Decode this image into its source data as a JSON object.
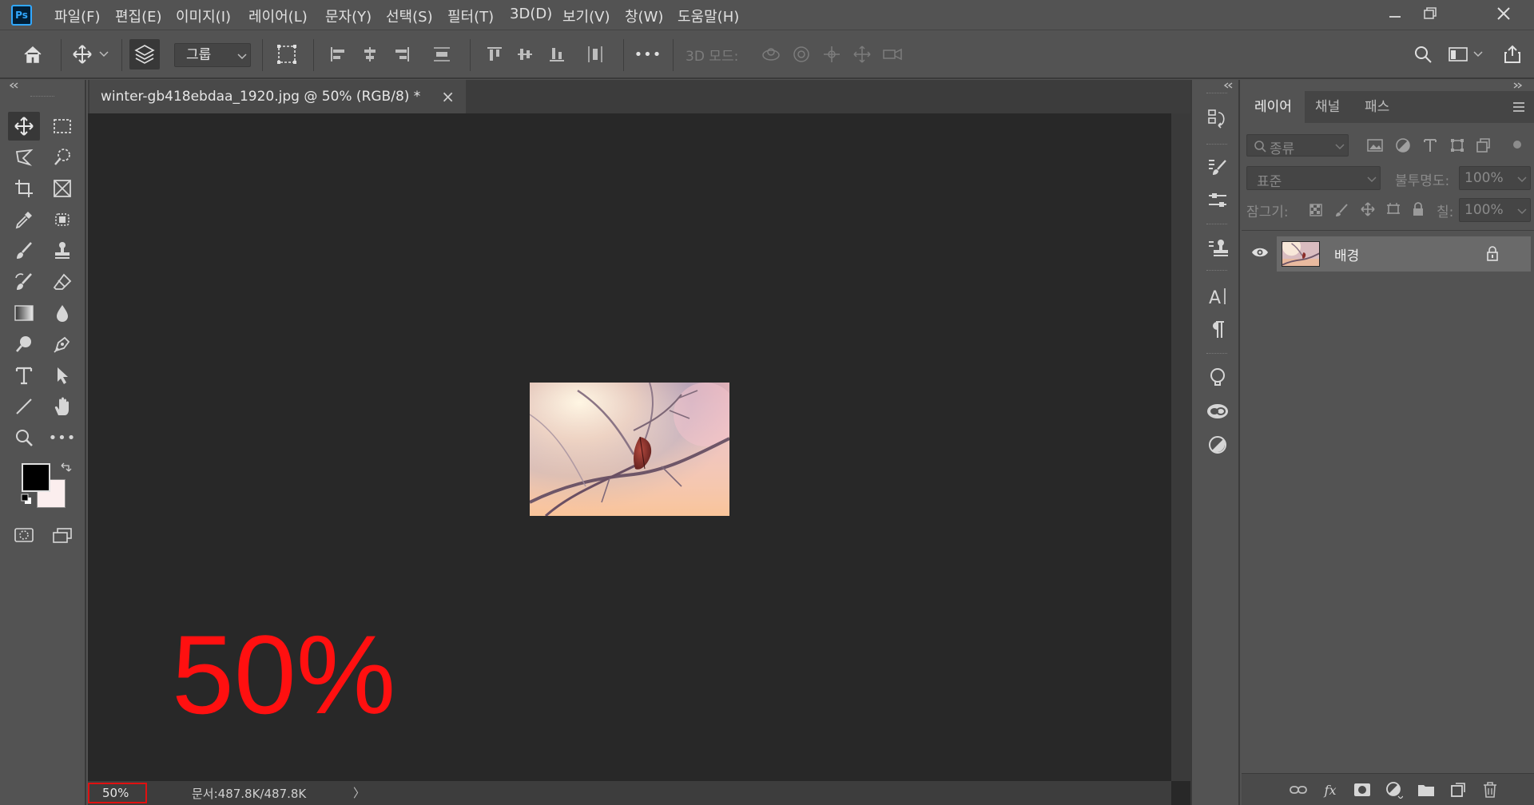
{
  "app": {
    "logo": "Ps"
  },
  "menu": [
    "파일(F)",
    "편집(E)",
    "이미지(I)",
    "레이어(L)",
    "문자(Y)",
    "선택(S)",
    "필터(T)",
    "3D(D)",
    "보기(V)",
    "창(W)",
    "도움말(H)"
  ],
  "options": {
    "group_label": "그룹",
    "mode3d_label": "3D 모드:",
    "more_label": "•••"
  },
  "document": {
    "tab_title": "winter-gb418ebdaa_1920.jpg @ 50% (RGB/8) *",
    "tab_close": "×",
    "zoom_overlay": "50%"
  },
  "status": {
    "zoom": "50%",
    "doc_info": "문서:487.8K/487.8K",
    "arrow": "〉"
  },
  "layers_panel": {
    "tabs": [
      "레이어",
      "채널",
      "패스"
    ],
    "filter_placeholder": "종류",
    "blend_mode": "표준",
    "opacity_label": "불투명도:",
    "opacity_value": "100%",
    "lock_label": "잠그기:",
    "fill_label": "칠:",
    "fill_value": "100%",
    "layer_name": "배경"
  },
  "icons": {
    "toolbox": [
      "move-icon",
      "marquee-icon",
      "lasso-icon",
      "quick-select-icon",
      "crop-icon",
      "frame-icon",
      "eyedropper-icon",
      "patch-icon",
      "brush-icon",
      "stamp-icon",
      "history-brush-icon",
      "eraser-icon",
      "gradient-icon",
      "blur-icon",
      "dodge-icon",
      "pen-icon",
      "type-icon",
      "path-select-icon",
      "line-icon",
      "hand-icon",
      "zoom-icon",
      "more-tools-icon"
    ]
  },
  "colors": {
    "foreground": "#000000",
    "background": "#fbeeee",
    "accent": "#31a8ff",
    "highlight_red": "#ff1010"
  }
}
